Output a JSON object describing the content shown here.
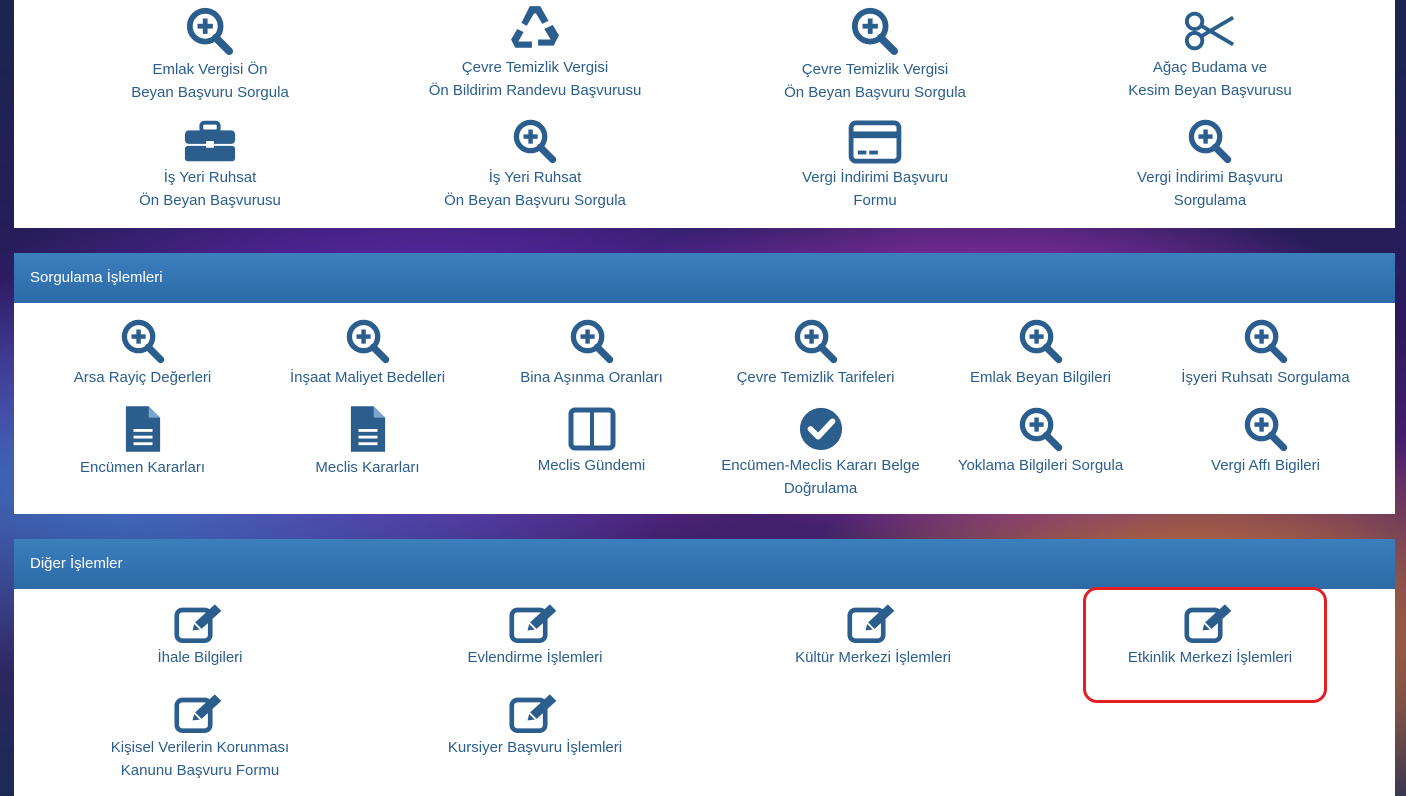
{
  "top_section": {
    "tiles": [
      {
        "label_l1": "Emlak Vergisi Ön",
        "label_l2": "Beyan Başvuru Sorgula",
        "icon": "search-plus-icon"
      },
      {
        "label_l1": "Çevre Temizlik Vergisi",
        "label_l2": "Ön Bildirim Randevu Başvurusu",
        "icon": "recycle-icon"
      },
      {
        "label_l1": "Çevre Temizlik Vergisi",
        "label_l2": "Ön Beyan Başvuru Sorgula",
        "icon": "search-plus-icon"
      },
      {
        "label_l1": "Ağaç Budama ve",
        "label_l2": "Kesim Beyan Başvurusu",
        "icon": "scissors-icon"
      },
      {
        "label_l1": "İş Yeri Ruhsat",
        "label_l2": "Ön Beyan Başvurusu",
        "icon": "briefcase-icon"
      },
      {
        "label_l1": "İş Yeri Ruhsat",
        "label_l2": "Ön Beyan Başvuru Sorgula",
        "icon": "search-plus-icon"
      },
      {
        "label_l1": "Vergi İndirimi Başvuru",
        "label_l2": "Formu",
        "icon": "credit-card-icon"
      },
      {
        "label_l1": "Vergi İndirimi Başvuru",
        "label_l2": "Sorgulama",
        "icon": "search-plus-icon"
      }
    ]
  },
  "query_section": {
    "title": "Sorgulama İşlemleri",
    "tiles": [
      {
        "label_l1": "Arsa Rayiç Değerleri",
        "label_l2": "",
        "icon": "search-plus-icon"
      },
      {
        "label_l1": "İnşaat Maliyet Bedelleri",
        "label_l2": "",
        "icon": "search-plus-icon"
      },
      {
        "label_l1": "Bina Aşınma Oranları",
        "label_l2": "",
        "icon": "search-plus-icon"
      },
      {
        "label_l1": "Çevre Temizlik Tarifeleri",
        "label_l2": "",
        "icon": "search-plus-icon"
      },
      {
        "label_l1": "Emlak Beyan Bilgileri",
        "label_l2": "",
        "icon": "search-plus-icon"
      },
      {
        "label_l1": "İşyeri Ruhsatı Sorgulama",
        "label_l2": "",
        "icon": "search-plus-icon"
      },
      {
        "label_l1": "Encümen Kararları",
        "label_l2": "",
        "icon": "document-icon"
      },
      {
        "label_l1": "Meclis Kararları",
        "label_l2": "",
        "icon": "document-icon"
      },
      {
        "label_l1": "Meclis Gündemi",
        "label_l2": "",
        "icon": "columns-icon"
      },
      {
        "label_l1": "Encümen-Meclis Kararı Belge",
        "label_l2": "Doğrulama",
        "icon": "check-circle-icon"
      },
      {
        "label_l1": "Yoklama Bilgileri Sorgula",
        "label_l2": "",
        "icon": "search-plus-icon"
      },
      {
        "label_l1": "Vergi Affı Bigileri",
        "label_l2": "",
        "icon": "search-plus-icon"
      }
    ]
  },
  "other_section": {
    "title": "Diğer İşlemler",
    "tiles": [
      {
        "label_l1": "İhale Bilgileri",
        "label_l2": "",
        "icon": "edit-icon"
      },
      {
        "label_l1": "Evlendirme İşlemleri",
        "label_l2": "",
        "icon": "edit-icon"
      },
      {
        "label_l1": "Kültür Merkezi İşlemleri",
        "label_l2": "",
        "icon": "edit-icon"
      },
      {
        "label_l1": "Etkinlik Merkezi İşlemleri",
        "label_l2": "",
        "icon": "edit-icon"
      },
      {
        "label_l1": "Kişisel Verilerin Korunması",
        "label_l2": "Kanunu Başvuru Formu",
        "icon": "edit-icon"
      },
      {
        "label_l1": "Kursiyer Başvuru İşlemleri",
        "label_l2": "",
        "icon": "edit-icon"
      }
    ]
  },
  "colors": {
    "accent": "#2b5d8d",
    "header": "#3477b5",
    "highlight": "#e31f26"
  }
}
